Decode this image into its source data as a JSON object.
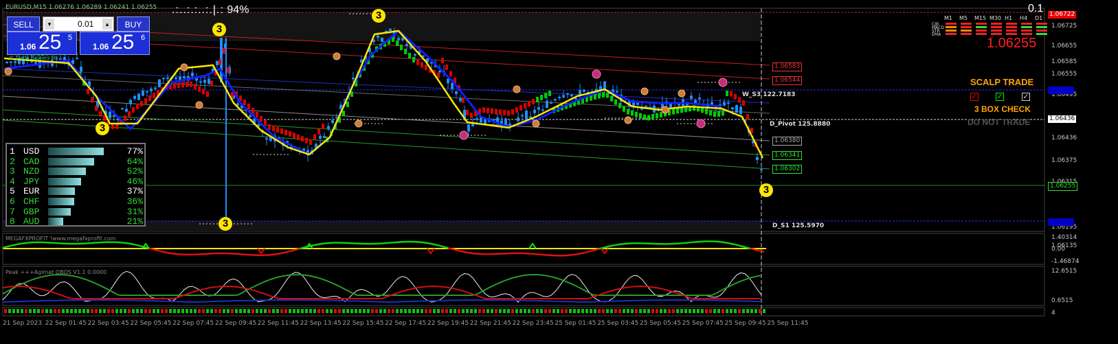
{
  "symbol_header": "EURUSD,M15  1.06276 1.06289 1.06241 1.06255",
  "percent_display": "94%",
  "lot_spread": "0.1",
  "trade_panel": {
    "sell_label": "SELL",
    "buy_label": "BUY",
    "lot_value": "0.01",
    "sell_price_small": "1.06",
    "sell_price_big": "25",
    "sell_price_sup": "5",
    "buy_price_small": "1.06",
    "buy_price_big": "25",
    "buy_price_sup": "6"
  },
  "mtf": {
    "timeframes": [
      "M1",
      "M5",
      "M15",
      "M30",
      "H1",
      "H4",
      "D1"
    ],
    "rows": [
      "CJB",
      "MACD",
      "STR",
      "EMA"
    ],
    "current_price": "1.06255"
  },
  "scalp": {
    "title": "SCALP TRADE",
    "box_check": "3 BOX CHECK",
    "do_not_trade": "DO NOT TRADE"
  },
  "strength": [
    {
      "rank": "1",
      "currency": "USD",
      "value": 77,
      "label": "77%"
    },
    {
      "rank": "2",
      "currency": "CAD",
      "value": 64,
      "label": "64%"
    },
    {
      "rank": "3",
      "currency": "NZD",
      "value": 52,
      "label": "52%"
    },
    {
      "rank": "4",
      "currency": "JPY",
      "value": 46,
      "label": "46%"
    },
    {
      "rank": "5",
      "currency": "EUR",
      "value": 37,
      "label": "37%"
    },
    {
      "rank": "6",
      "currency": "CHF",
      "value": 36,
      "label": "36%"
    },
    {
      "rank": "7",
      "currency": "GBP",
      "value": 31,
      "label": "31%"
    },
    {
      "rank": "8",
      "currency": "AUD",
      "value": 21,
      "label": "21%"
    }
  ],
  "price_axis": [
    "1.06725",
    "1.06655",
    "1.06585",
    "1.06555",
    "1.06495",
    "1.06436",
    "1.06375",
    "1.06315",
    "1.06255",
    "1.06195",
    "1.06135"
  ],
  "level_labels": {
    "r1": "1.06583",
    "r2": "1.06544",
    "w_s3": "W_S3 122.7183",
    "pivot": "D_Pivot 125.8880",
    "l1": "1.06380",
    "l2": "1.06341",
    "l3": "1.06302",
    "s1": "D_S1 125.5970",
    "bid_box": "1.06436",
    "cur_box": "1.06255",
    "top_box": "1.06722",
    "blue_box1": "",
    "blue_box2": ""
  },
  "indicator1": {
    "title": "MEGAFXPROFIT  !www.megafxprofit.com",
    "axis": [
      "1.40314",
      "0.00",
      "-1.46874"
    ]
  },
  "indicator2": {
    "title": "Peak  +++Agimat OBOS V1.1 0.0000",
    "axis": [
      "12.6515",
      "0.6515"
    ]
  },
  "time_axis": [
    "21 Sep 2023",
    "22 Sep 01:45",
    "22 Sep 03:45",
    "22 Sep 05:45",
    "22 Sep 07:45",
    "22 Sep 09:45",
    "22 Sep 11:45",
    "22 Sep 13:45",
    "22 Sep 15:45",
    "22 Sep 17:45",
    "22 Sep 19:45",
    "22 Sep 21:45",
    "22 Sep 23:45",
    "25 Sep 01:45",
    "25 Sep 03:45",
    "25 Sep 05:45",
    "25 Sep 07:45",
    "25 Sep 09:45",
    "25 Sep 11:45"
  ],
  "watermark_text": "© Trade Brokers Ru",
  "colors": {
    "bull": "#00e000",
    "bear": "#e00000",
    "blue": "#1e90ff",
    "yellow": "#ffe600",
    "navy": "#0000ff"
  }
}
